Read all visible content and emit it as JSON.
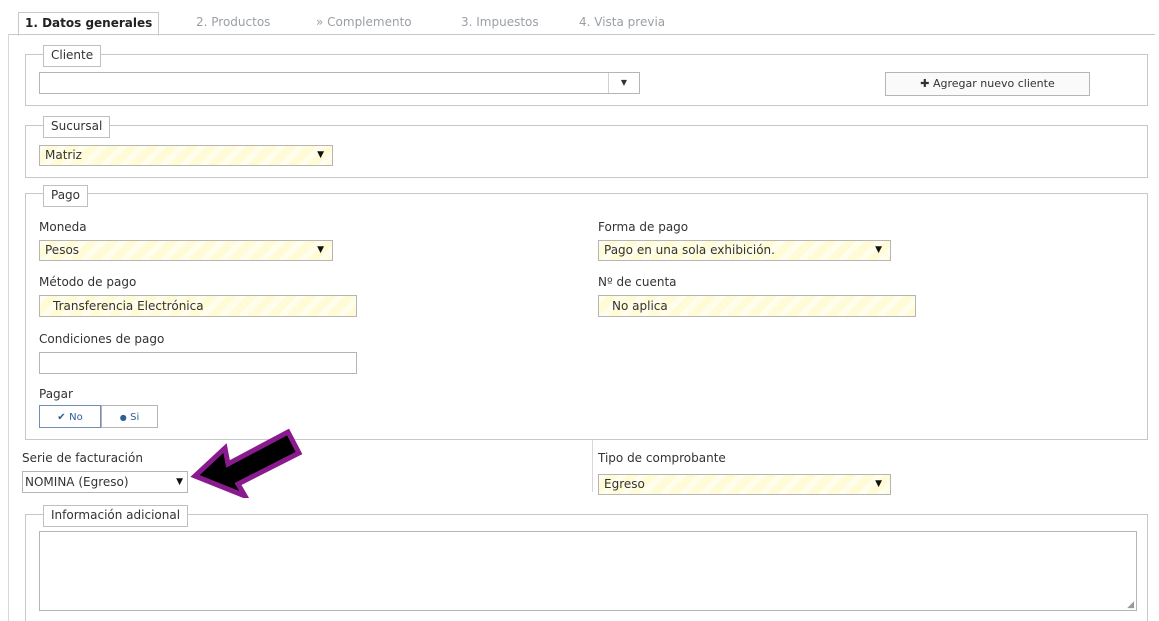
{
  "tabs": [
    {
      "label": "1. Datos generales",
      "active": true
    },
    {
      "label": "2. Productos"
    },
    {
      "label": "» Complemento"
    },
    {
      "label": "3. Impuestos"
    },
    {
      "label": "4. Vista previa"
    }
  ],
  "cliente": {
    "legend": "Cliente",
    "select_value": "",
    "add_button": "Agregar nuevo cliente",
    "add_icon": "plus-icon"
  },
  "sucursal": {
    "legend": "Sucursal",
    "value": "Matriz"
  },
  "pago": {
    "legend": "Pago",
    "moneda_label": "Moneda",
    "moneda_value": "Pesos",
    "forma_label": "Forma de pago",
    "forma_value": "Pago en una sola exhibición.",
    "metodo_label": "Método de pago",
    "metodo_value": "Transferencia Electrónica",
    "cuenta_label": "Nº de cuenta",
    "cuenta_value": "No aplica",
    "condiciones_label": "Condiciones de pago",
    "condiciones_value": "",
    "pagar_label": "Pagar",
    "pagar_no": "No",
    "pagar_si": "Si"
  },
  "serie": {
    "label": "Serie de facturación",
    "value": "NOMINA (Egreso)"
  },
  "tipo": {
    "label": "Tipo de comprobante",
    "value": "Egreso"
  },
  "info": {
    "legend": "Información adicional",
    "value": ""
  },
  "colors": {
    "highlight_field": "#fffbd6",
    "arrow_fill": "#000000",
    "arrow_outline": "#8a1b8f",
    "border": "#c8c8c8"
  }
}
